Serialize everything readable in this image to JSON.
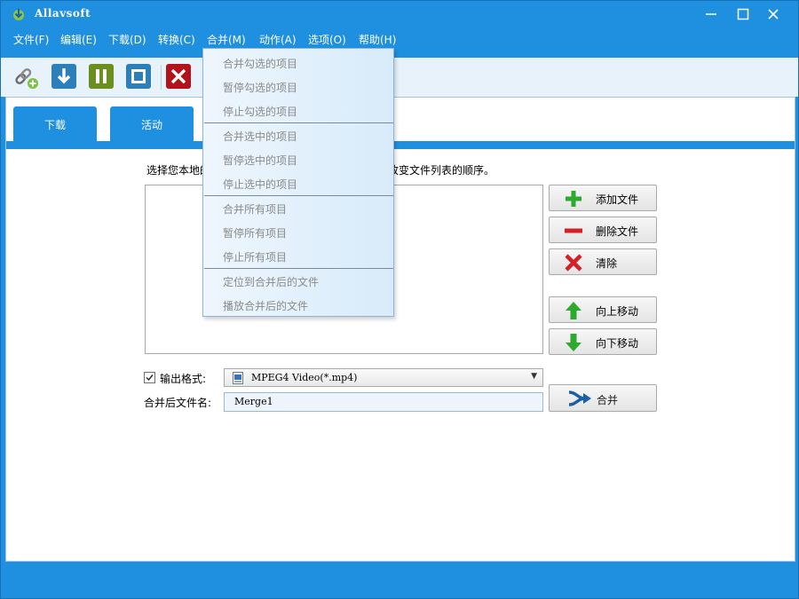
{
  "window": {
    "title": "Allavsoft"
  },
  "menu": [
    "文件(F)",
    "编辑(E)",
    "下载(D)",
    "转换(C)",
    "合并(M)",
    "动作(A)",
    "选项(O)",
    "帮助(H)"
  ],
  "toolbar": {
    "icons": [
      "add-link-icon",
      "download-icon",
      "pause-icon",
      "stop-icon",
      "delete-icon"
    ]
  },
  "tabs": [
    "下载",
    "活动"
  ],
  "merge_panel": {
    "instruction_head": "选择您本地的",
    "instruction_tail": "改变文件列表的顺序。",
    "buttons": {
      "add_files": "添加文件",
      "delete_files": "删除文件",
      "clear": "清除",
      "move_up": "向上移动",
      "move_down": "向下移动",
      "merge": "合并"
    },
    "output_format_label": "输出格式:",
    "output_format_value": "MPEG4 Video(*.mp4)",
    "output_format_checked": true,
    "output_name_label": "合并后文件名:",
    "output_name_value": "Merge1"
  },
  "dropdown": {
    "groups": [
      [
        "合并勾选的项目",
        "暂停勾选的项目",
        "停止勾选的项目"
      ],
      [
        "合并选中的项目",
        "暂停选中的项目",
        "停止选中的项目"
      ],
      [
        "合并所有项目",
        "暂停所有项目",
        "停止所有项目"
      ],
      [
        "定位到合并后的文件",
        "播放合并后的文件"
      ]
    ]
  },
  "colors": {
    "accent": "#1f8fe0",
    "toolbar_bg": "#e8f2fb",
    "disabled_text": "#8a8a8a"
  }
}
